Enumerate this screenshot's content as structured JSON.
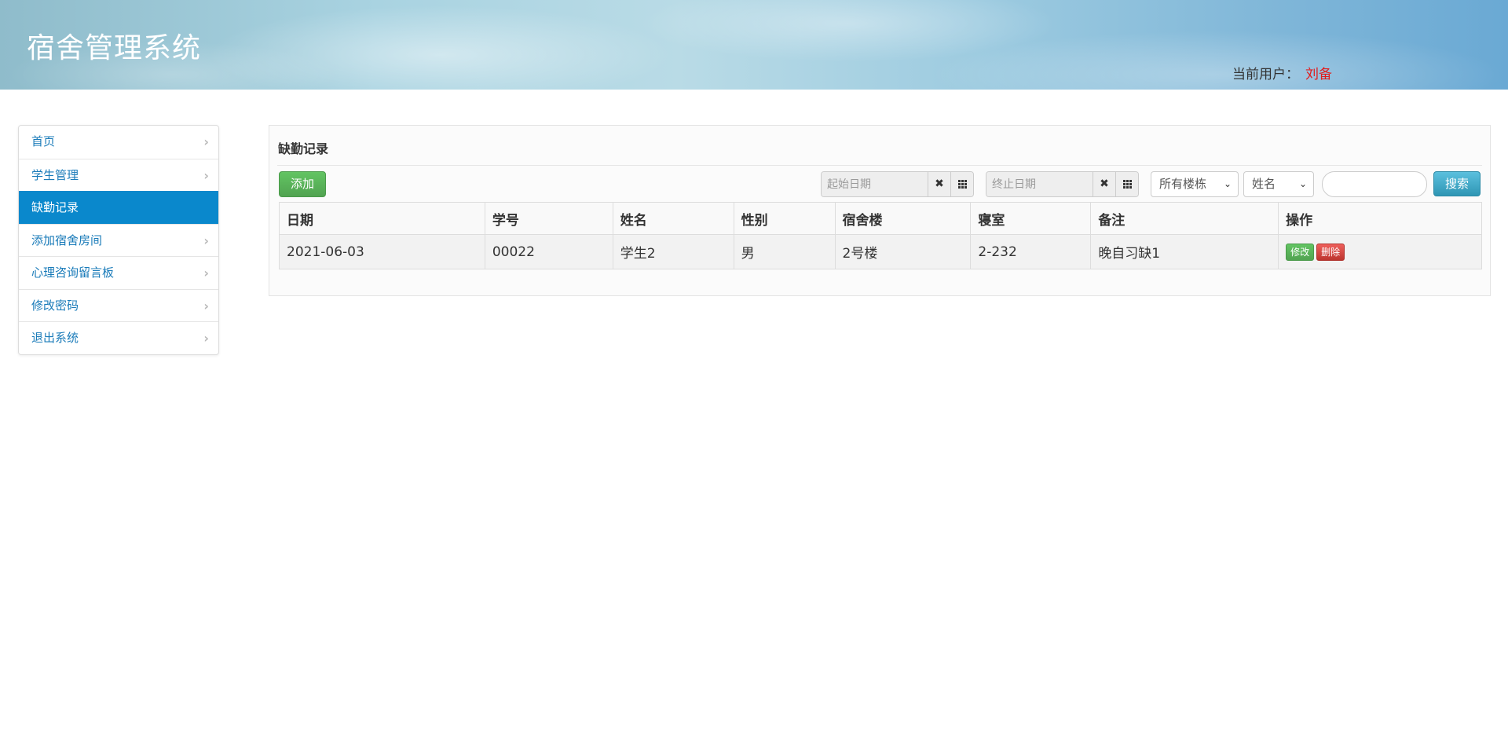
{
  "header": {
    "title": "宿舍管理系统",
    "user_label": "当前用户：",
    "user_name": "刘备"
  },
  "sidebar": {
    "items": [
      {
        "label": "首页",
        "active": false
      },
      {
        "label": "学生管理",
        "active": false
      },
      {
        "label": "缺勤记录",
        "active": true
      },
      {
        "label": "添加宿舍房间",
        "active": false
      },
      {
        "label": "心理咨询留言板",
        "active": false
      },
      {
        "label": "修改密码",
        "active": false
      },
      {
        "label": "退出系统",
        "active": false
      }
    ]
  },
  "main": {
    "title": "缺勤记录",
    "add_label": "添加",
    "start_date_placeholder": "起始日期",
    "end_date_placeholder": "终止日期",
    "building_select": "所有楼栋",
    "field_select": "姓名",
    "search_label": "搜索",
    "table": {
      "headers": [
        "日期",
        "学号",
        "姓名",
        "性别",
        "宿舍楼",
        "寝室",
        "备注",
        "操作"
      ],
      "rows": [
        {
          "date": "2021-06-03",
          "student_no": "00022",
          "name": "学生2",
          "gender": "男",
          "building": "2号楼",
          "room": "2-232",
          "note": "晚自习缺1",
          "edit_label": "修改",
          "delete_label": "删除"
        }
      ]
    }
  },
  "colors": {
    "active_nav": "#0a88cc",
    "link": "#1a7bb9",
    "user_name": "#e21b1b",
    "success": "#51a351",
    "danger": "#bd362f",
    "info": "#2f96b4"
  },
  "icons": {
    "nav_chevron": "chevron-right-icon",
    "date_clear": "close-icon",
    "date_picker": "calendar-grid-icon",
    "select_caret": "chevron-down-icon"
  }
}
